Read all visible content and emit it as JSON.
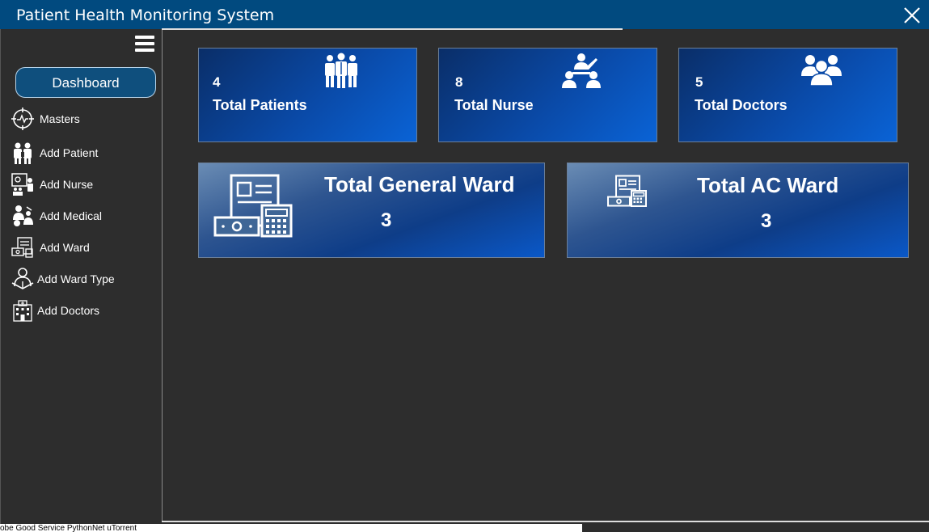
{
  "window": {
    "title": "Patient Health Monitoring System"
  },
  "sidebar": {
    "dashboard_label": "Dashboard",
    "items": [
      {
        "label": "Masters",
        "icon": "masters-icon"
      },
      {
        "label": "Add  Patient",
        "icon": "patient-icon"
      },
      {
        "label": "Add Nurse",
        "icon": "nurse-icon"
      },
      {
        "label": "Add Medical",
        "icon": "medical-icon"
      },
      {
        "label": "Add Ward",
        "icon": "ward-icon"
      },
      {
        "label": "Add Ward Type",
        "icon": "ward-type-icon"
      },
      {
        "label": "Add Doctors",
        "icon": "doctors-icon"
      }
    ]
  },
  "stats": [
    {
      "value": "4",
      "label": "Total Patients",
      "icon": "patients-group-icon"
    },
    {
      "value": "8",
      "label": "Total Nurse",
      "icon": "nurse-team-icon"
    },
    {
      "value": "5",
      "label": "Total Doctors",
      "icon": "doctors-group-icon"
    }
  ],
  "wards": [
    {
      "title": "Total General Ward",
      "value": "3",
      "icon": "invoice-calculator-icon"
    },
    {
      "title": "Total AC Ward",
      "value": "3",
      "icon": "invoice-calculator-icon"
    }
  ],
  "taskbar_text": "obe     Good Service  PythonNet         uTorrent",
  "colors": {
    "titlebar": "#014a7f",
    "background": "#2d2d2d",
    "card_blue": "#0a4aa8"
  }
}
